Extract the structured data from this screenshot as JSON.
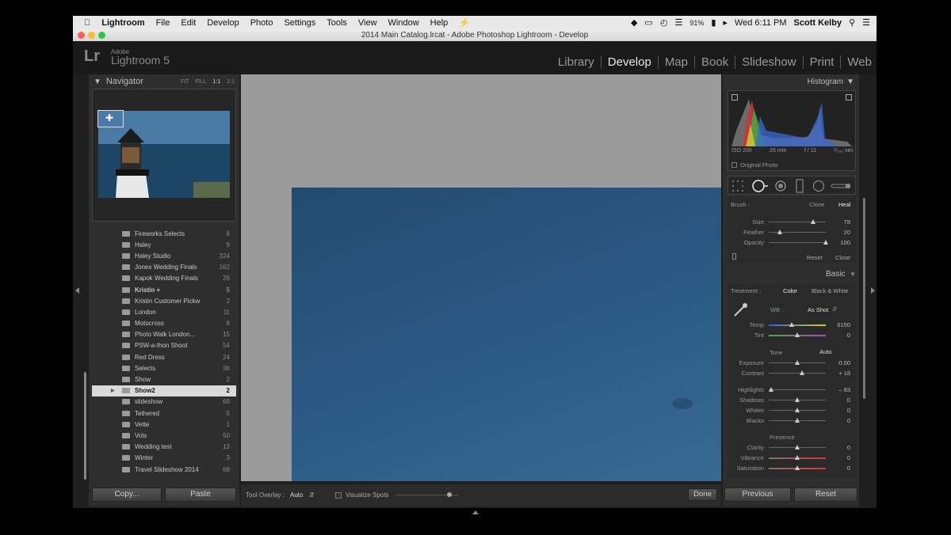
{
  "menubar": {
    "app": "Lightroom",
    "items": [
      "File",
      "Edit",
      "Develop",
      "Photo",
      "Settings",
      "Tools",
      "View",
      "Window",
      "Help"
    ],
    "battery": "91%",
    "clock": "Wed 6:11 PM",
    "user": "Scott Kelby"
  },
  "window": {
    "title": "2014 Main Catalog.lrcat - Adobe Photoshop Lightroom - Develop"
  },
  "identity": {
    "lr": "Lr",
    "adobe": "Adobe",
    "product": "Lightroom 5"
  },
  "modules": [
    "Library",
    "Develop",
    "Map",
    "Book",
    "Slideshow",
    "Print",
    "Web"
  ],
  "active_module": "Develop",
  "navigator": {
    "title": "Navigator",
    "zooms": [
      "FIT",
      "FILL",
      "1:1",
      "2:1"
    ]
  },
  "folders": [
    {
      "name": "Fireworks Selects",
      "count": "6"
    },
    {
      "name": "Haley",
      "count": "9"
    },
    {
      "name": "Haley Studio",
      "count": "324"
    },
    {
      "name": "Jones Wedding Finals",
      "count": "162"
    },
    {
      "name": "Kapok Wedding Finals",
      "count": "26"
    },
    {
      "name": "Kristin  +",
      "count": "5",
      "bold": true
    },
    {
      "name": "Kristin Customer Pickw",
      "count": "2"
    },
    {
      "name": "London",
      "count": "11"
    },
    {
      "name": "Motocross",
      "count": "8"
    },
    {
      "name": "Photo Walk London...",
      "count": "15"
    },
    {
      "name": "PSW-a-thon Shoot",
      "count": "54"
    },
    {
      "name": "Red Dress",
      "count": "24"
    },
    {
      "name": "Selects",
      "count": "36"
    },
    {
      "name": "Show",
      "count": "2"
    },
    {
      "name": "Show2",
      "count": "2",
      "selected": true
    },
    {
      "name": "slideshow",
      "count": "68"
    },
    {
      "name": "Tethered",
      "count": "5"
    },
    {
      "name": "Vette",
      "count": "1"
    },
    {
      "name": "Vols",
      "count": "50"
    },
    {
      "name": "Wedding test",
      "count": "13"
    },
    {
      "name": "Winter",
      "count": "3"
    },
    {
      "name": "Travel Slideshow 2014",
      "count": "68"
    }
  ],
  "left_buttons": {
    "copy": "Copy...",
    "paste": "Paste"
  },
  "toolbar": {
    "overlay_label": "Tool Overlay :",
    "overlay_value": "Auto",
    "visualize": "Visualize Spots",
    "done": "Done"
  },
  "histogram": {
    "title": "Histogram",
    "iso": "ISO 200",
    "focal": "26 mm",
    "aperture": "f / 11",
    "shutter": "¹⁄₁₀₀ sec",
    "original": "Original Photo"
  },
  "spot": {
    "brush": "Brush :",
    "clone": "Clone",
    "heal": "Heal",
    "size_label": "Size",
    "size": "78",
    "size_pos": 0.78,
    "feather_label": "Feather",
    "feather": "20",
    "feather_pos": 0.2,
    "opacity_label": "Opacity",
    "opacity": "100",
    "opacity_pos": 1.0,
    "reset": "Reset",
    "close": "Close"
  },
  "basic": {
    "title": "Basic",
    "treatment": "Treatment :",
    "color": "Color",
    "bw": "Black & White",
    "wb_label": "WB :",
    "wb": "As Shot",
    "tone": "Tone",
    "auto": "Auto",
    "presence": "Presence",
    "sliders": [
      {
        "label": "Temp",
        "value": "6150",
        "pos": 0.4,
        "group": "wb"
      },
      {
        "label": "Tint",
        "value": "0",
        "pos": 0.5,
        "group": "wb"
      },
      {
        "label": "Exposure",
        "value": "0.00",
        "pos": 0.5,
        "group": "tone"
      },
      {
        "label": "Contrast",
        "value": "+ 18",
        "pos": 0.59,
        "group": "tone"
      },
      {
        "label": "Highlights",
        "value": "– 93",
        "pos": 0.04,
        "group": "tone2"
      },
      {
        "label": "Shadows",
        "value": "0",
        "pos": 0.5,
        "group": "tone2"
      },
      {
        "label": "Whites",
        "value": "0",
        "pos": 0.5,
        "group": "tone2"
      },
      {
        "label": "Blacks",
        "value": "0",
        "pos": 0.5,
        "group": "tone2"
      },
      {
        "label": "Clarity",
        "value": "0",
        "pos": 0.5,
        "group": "presence"
      },
      {
        "label": "Vibrance",
        "value": "0",
        "pos": 0.5,
        "group": "presence"
      },
      {
        "label": "Saturation",
        "value": "0",
        "pos": 0.5,
        "group": "presence"
      }
    ]
  },
  "right_buttons": {
    "previous": "Previous",
    "reset": "Reset"
  },
  "colors": {
    "accent": "#e8e8e8",
    "panel": "#2e2e2e",
    "canvas": "#9b9b9b"
  }
}
